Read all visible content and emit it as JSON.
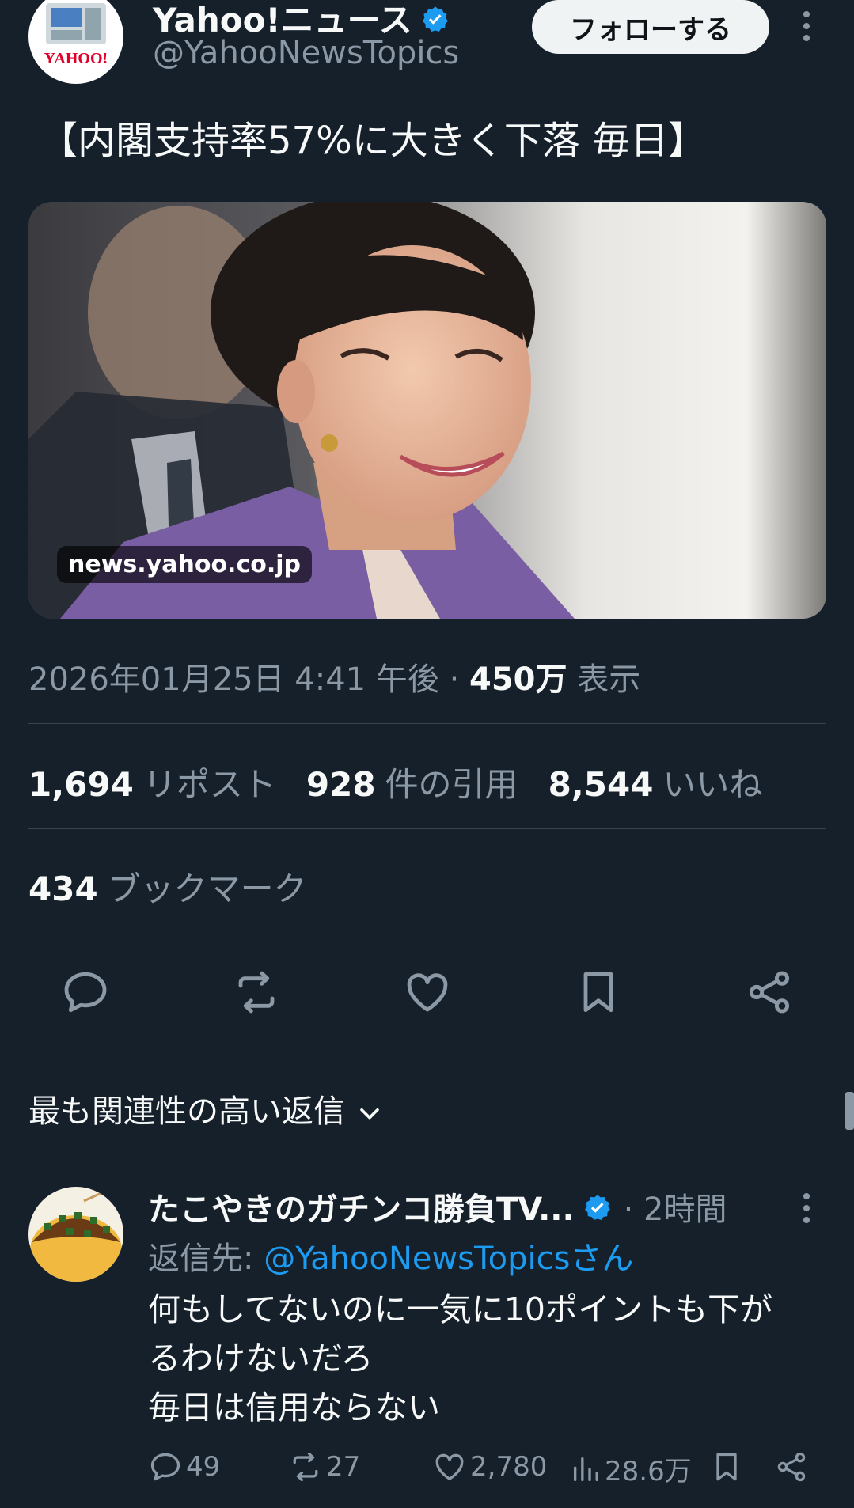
{
  "post": {
    "account_name": "Yahoo!ニュース",
    "account_handle": "@YahooNewsTopics",
    "avatar_logo_text": "YAHOO!",
    "follow_label": "フォローする",
    "headline": "【内閣支持率57%に大きく下落 毎日】",
    "media_domain": "news.yahoo.co.jp",
    "timestamp": "2026年01月25日 4:41 午後",
    "separator": "·",
    "views_count": "450万",
    "views_label": "表示",
    "reposts_count": "1,694",
    "reposts_label": "リポスト",
    "quotes_count": "928",
    "quotes_label": "件の引用",
    "likes_count": "8,544",
    "likes_label": "いいね",
    "bookmarks_count": "434",
    "bookmarks_label": "ブックマーク"
  },
  "replies_section": {
    "sort_label": "最も関連性の高い返信"
  },
  "reply": {
    "author_name": "たこやきのガチンコ勝負TV...",
    "time": "· 2時間",
    "reply_prefix": "返信先:",
    "reply_to": "@YahooNewsTopicsさん",
    "body_lines": [
      "何もしてないのに一気に10ポイントも下が",
      "るわけないだろ",
      "毎日は信用ならない"
    ],
    "replies": "49",
    "reposts": "27",
    "likes": "2,780",
    "views": "28.6万"
  },
  "colors": {
    "background": "#15202b",
    "accent": "#1d9bf0",
    "muted": "#8b98a5",
    "divider": "#38444d"
  },
  "icons": [
    "verified-badge-icon",
    "more-icon",
    "reply-icon",
    "repost-icon",
    "like-icon",
    "bookmark-icon",
    "share-icon",
    "chevron-down-icon",
    "views-icon"
  ]
}
